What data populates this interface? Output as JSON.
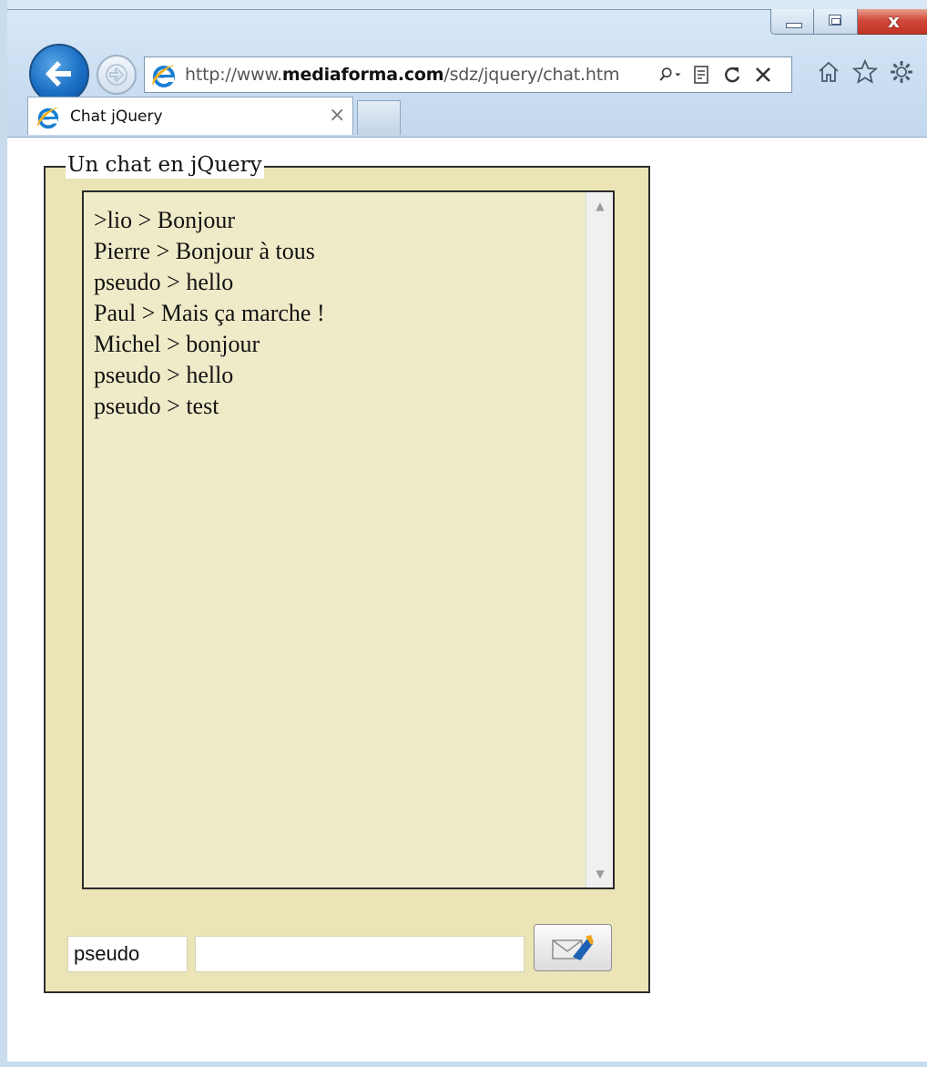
{
  "browser": {
    "url_prefix": "http://www.",
    "url_domain": "mediaforma.com",
    "url_path": "/sdz/jquery/chat.htm",
    "tab_title": "Chat jQuery",
    "tab_close": "×",
    "close_glyph": "x",
    "icons": {
      "back": "back-arrow-icon",
      "forward": "forward-arrow-icon",
      "site": "ie-logo-icon",
      "search": "search-icon",
      "compat": "compatibility-view-icon",
      "refresh": "refresh-icon",
      "stop": "stop-icon",
      "home": "home-icon",
      "favorites": "star-icon",
      "tools": "gear-icon"
    }
  },
  "page": {
    "legend": "Un chat en jQuery",
    "messages": [
      ">lio > Bonjour",
      "Pierre > Bonjour à tous",
      "pseudo > hello",
      "Paul > Mais ça marche !",
      "Michel > bonjour",
      "pseudo > hello",
      "pseudo > test"
    ],
    "pseudo_value": "pseudo",
    "message_value": "",
    "send_icon": "send-mail-icon"
  },
  "colors": {
    "fieldset_bg": "#eae4b6",
    "chat_bg": "#efebc9",
    "close_button": "#c23524"
  }
}
